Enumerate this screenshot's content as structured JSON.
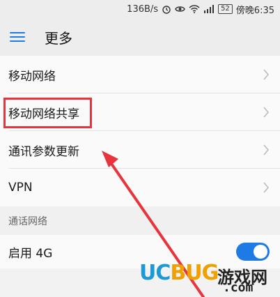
{
  "status_bar": {
    "net_speed": "136B/s",
    "battery": "52",
    "time": "傍晚6:35"
  },
  "app_bar": {
    "title": "更多"
  },
  "list": {
    "items": [
      {
        "label": "移动网络"
      },
      {
        "label": "移动网络共享"
      },
      {
        "label": "通讯参数更新"
      },
      {
        "label": "VPN"
      }
    ]
  },
  "call_network": {
    "section_title": "通话网络",
    "enable_4g_label": "启用 4G",
    "enable_4g_on": true
  },
  "watermark": {
    "uc": "UC",
    "bug": "BUG",
    "cn": "游戏网",
    "com": ".com"
  },
  "colors": {
    "accent": "#1e7be6",
    "highlight": "#e8343c"
  }
}
